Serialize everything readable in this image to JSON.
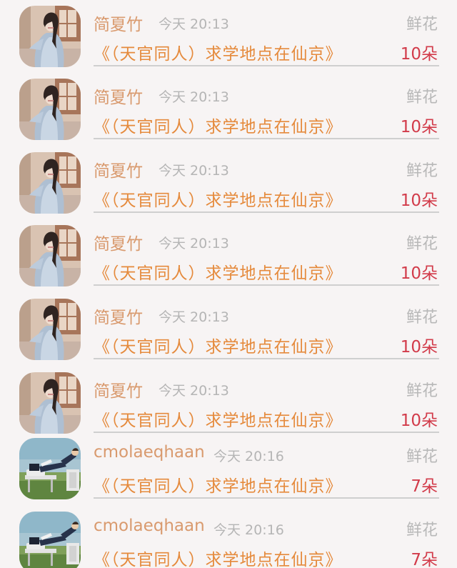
{
  "rows": [
    {
      "avatar": "woman-hanfu-avatar",
      "name": "简夏竹",
      "time": "今天 20:13",
      "gift": "鲜花",
      "title": "《（天官同人）求学地点在仙京》",
      "count": "10朵"
    },
    {
      "avatar": "woman-hanfu-avatar",
      "name": "简夏竹",
      "time": "今天 20:13",
      "gift": "鲜花",
      "title": "《（天官同人）求学地点在仙京》",
      "count": "10朵"
    },
    {
      "avatar": "woman-hanfu-avatar",
      "name": "简夏竹",
      "time": "今天 20:13",
      "gift": "鲜花",
      "title": "《（天官同人）求学地点在仙京》",
      "count": "10朵"
    },
    {
      "avatar": "woman-hanfu-avatar",
      "name": "简夏竹",
      "time": "今天 20:13",
      "gift": "鲜花",
      "title": "《（天官同人）求学地点在仙京》",
      "count": "10朵"
    },
    {
      "avatar": "woman-hanfu-avatar",
      "name": "简夏竹",
      "time": "今天 20:13",
      "gift": "鲜花",
      "title": "《（天官同人）求学地点在仙京》",
      "count": "10朵"
    },
    {
      "avatar": "woman-hanfu-avatar",
      "name": "简夏竹",
      "time": "今天 20:13",
      "gift": "鲜花",
      "title": "《（天官同人）求学地点在仙京》",
      "count": "10朵"
    },
    {
      "avatar": "man-lounging-avatar",
      "name": "cmolaeqhaan",
      "time": "今天 20:16",
      "gift": "鲜花",
      "title": "《（天官同人）求学地点在仙京》",
      "count": "7朵"
    },
    {
      "avatar": "man-lounging-avatar",
      "name": "cmolaeqhaan",
      "time": "今天 20:16",
      "gift": "鲜花",
      "title": "《（天官同人）求学地点在仙京》",
      "count": "7朵"
    }
  ]
}
